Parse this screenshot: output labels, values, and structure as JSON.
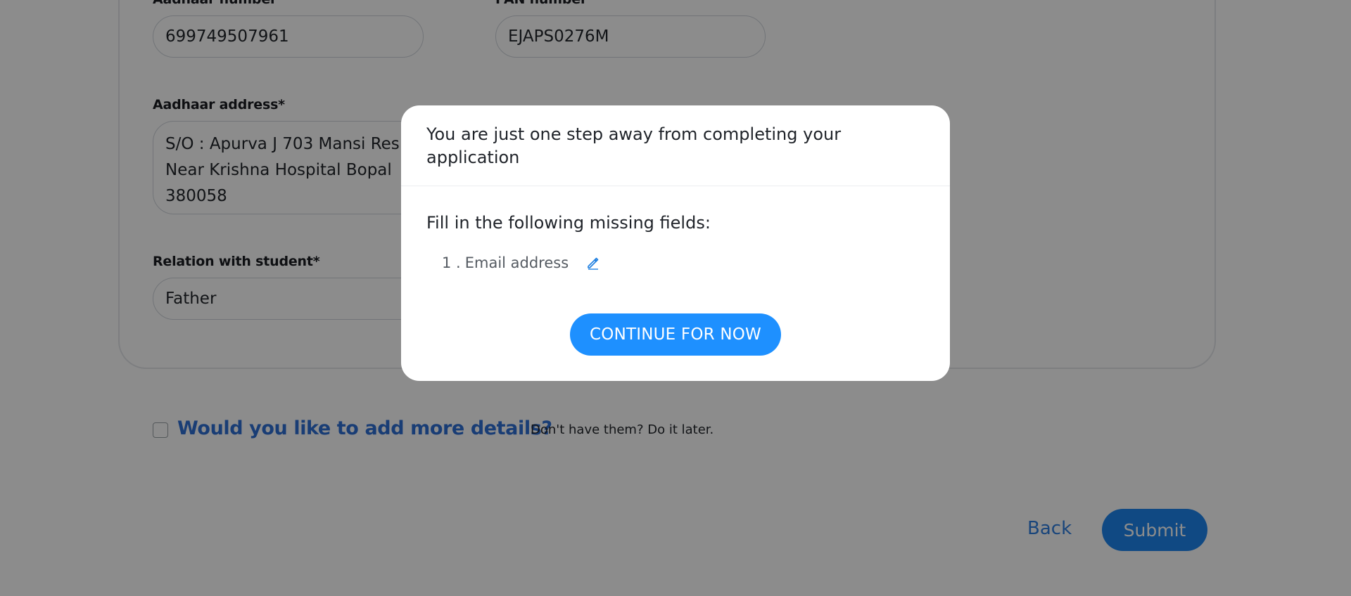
{
  "form": {
    "aadhaar_number_label": "Aadhaar number",
    "aadhaar_number_value": "699749507961",
    "pan_number_label": "PAN number",
    "pan_number_value": "EJAPS0276M",
    "aadhaar_address_label": "Aadhaar address*",
    "aadhaar_address_value": "S/O : Apurva J 703 Mansi Res\nNear Krishna Hospital Bopal\n380058",
    "relation_label": "Relation with student*",
    "relation_value": "Father"
  },
  "more_details": {
    "question": "Would you like to add more details?",
    "hint": "Don't have them? Do it later."
  },
  "footer": {
    "back_label": "Back",
    "submit_label": "Submit"
  },
  "modal": {
    "title": "You are just one step away from completing your application",
    "subtitle": "Fill in the following missing fields:",
    "missing_fields": [
      {
        "number": "1 .",
        "label": "Email address",
        "icon": "edit-icon"
      }
    ],
    "continue_label": "CONTINUE FOR NOW"
  },
  "colors": {
    "accent": "#1e90ff",
    "link": "#2f6fd6",
    "overlay": "rgba(0,0,0,0.45)"
  }
}
